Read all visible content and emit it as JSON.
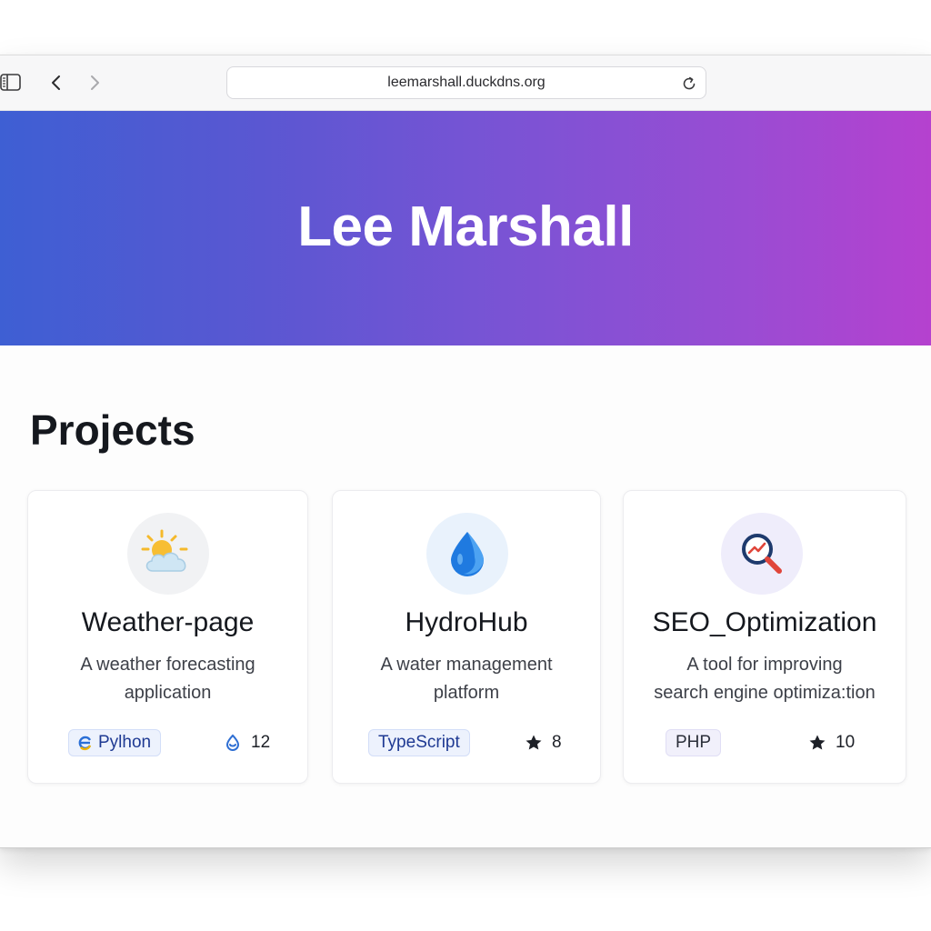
{
  "browser": {
    "url": "leemarshall.duckdns.org"
  },
  "hero": {
    "title": "Lee Marshall"
  },
  "projects": {
    "heading": "Projects",
    "items": [
      {
        "icon": "weather-sun-cloud-icon",
        "title": "Weather-page",
        "description_line1": "A weather forecasting",
        "description_line2": "application",
        "language": "Pylhon",
        "stat_icon": "droplet-badge-icon",
        "stat_value": "12"
      },
      {
        "icon": "water-drop-icon",
        "title": "HydroHub",
        "description_line1": "A water management",
        "description_line2": "platform",
        "language": "TypeScript",
        "stat_icon": "star-icon",
        "stat_value": "8"
      },
      {
        "icon": "magnifier-chart-icon",
        "title": "SEO_Optimization",
        "description_line1": "A tool for improving",
        "description_line2": "search engine optimiza:tion",
        "language": "PHP",
        "stat_icon": "star-icon",
        "stat_value": "10"
      }
    ]
  },
  "colors": {
    "hero_gradient_start": "#3e5fd3",
    "hero_gradient_end": "#b541cf",
    "badge_bg": "#edf2fd",
    "badge_text": "#1f3a93"
  }
}
